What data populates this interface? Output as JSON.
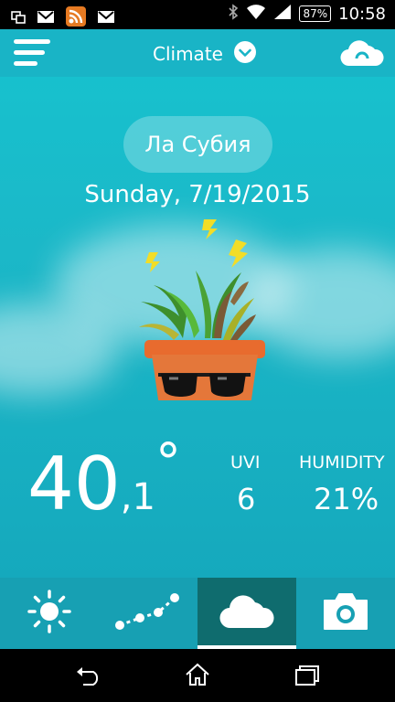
{
  "status_bar": {
    "battery": "87%",
    "time": "10:58"
  },
  "header": {
    "title": "Climate"
  },
  "location": "Ла Субия",
  "date": "Sunday, 7/19/2015",
  "weather": {
    "temp_int": "40",
    "temp_dec": ",1",
    "temp_unit": "°",
    "uvi_label": "UVI",
    "uvi_value": "6",
    "humidity_label": "HUMIDITY",
    "humidity_value": "21%"
  },
  "tabs": [
    {
      "icon": "sun-icon"
    },
    {
      "icon": "trend-icon"
    },
    {
      "icon": "cloud-icon",
      "active": true
    },
    {
      "icon": "camera-icon"
    }
  ],
  "colors": {
    "background": "#1bb8c8",
    "tabbar": "#17a0b3",
    "active_tab": "#0f6c6e"
  }
}
